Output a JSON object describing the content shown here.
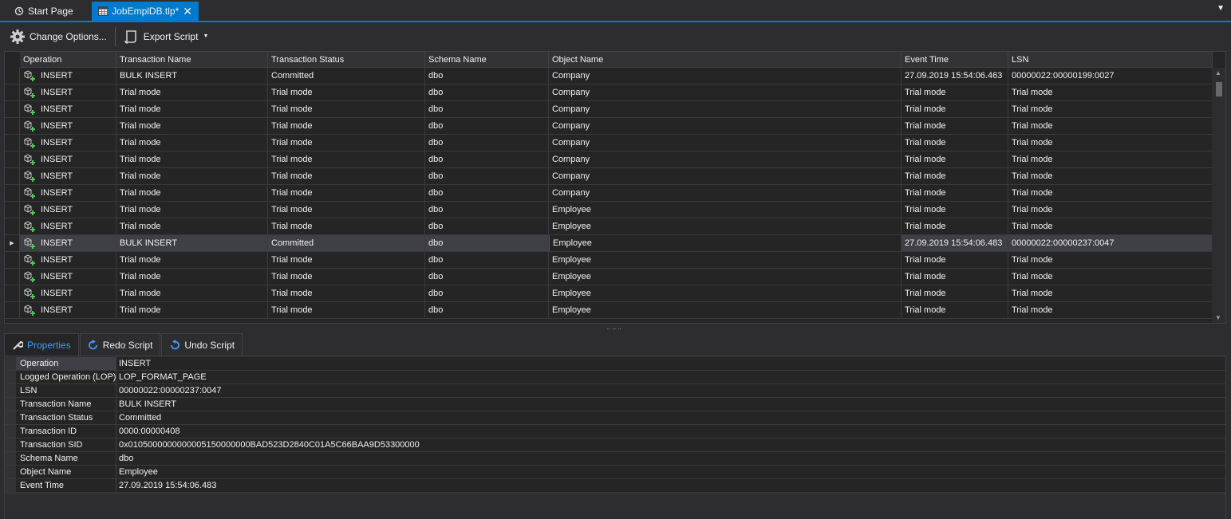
{
  "tabs": {
    "start_label": "Start Page",
    "doc_label": "JobEmplDB.tlp*",
    "close_glyph": "✕",
    "overflow_glyph": "▼"
  },
  "toolbar": {
    "options_label": "Change Options...",
    "export_label": "Export Script"
  },
  "grid": {
    "columns": [
      "Operation",
      "Transaction Name",
      "Transaction Status",
      "Schema Name",
      "Object Name",
      "Event Time",
      "LSN"
    ],
    "selected_row": 10,
    "rows": [
      [
        "INSERT",
        "BULK INSERT",
        "Committed",
        "dbo",
        "Company",
        "27.09.2019 15:54:06.463",
        "00000022:00000199:0027"
      ],
      [
        "INSERT",
        "Trial mode",
        "Trial mode",
        "dbo",
        "Company",
        "Trial mode",
        "Trial mode"
      ],
      [
        "INSERT",
        "Trial mode",
        "Trial mode",
        "dbo",
        "Company",
        "Trial mode",
        "Trial mode"
      ],
      [
        "INSERT",
        "Trial mode",
        "Trial mode",
        "dbo",
        "Company",
        "Trial mode",
        "Trial mode"
      ],
      [
        "INSERT",
        "Trial mode",
        "Trial mode",
        "dbo",
        "Company",
        "Trial mode",
        "Trial mode"
      ],
      [
        "INSERT",
        "Trial mode",
        "Trial mode",
        "dbo",
        "Company",
        "Trial mode",
        "Trial mode"
      ],
      [
        "INSERT",
        "Trial mode",
        "Trial mode",
        "dbo",
        "Company",
        "Trial mode",
        "Trial mode"
      ],
      [
        "INSERT",
        "Trial mode",
        "Trial mode",
        "dbo",
        "Company",
        "Trial mode",
        "Trial mode"
      ],
      [
        "INSERT",
        "Trial mode",
        "Trial mode",
        "dbo",
        "Employee",
        "Trial mode",
        "Trial mode"
      ],
      [
        "INSERT",
        "Trial mode",
        "Trial mode",
        "dbo",
        "Employee",
        "Trial mode",
        "Trial mode"
      ],
      [
        "INSERT",
        "BULK INSERT",
        "Committed",
        "dbo",
        "Employee",
        "27.09.2019 15:54:06.483",
        "00000022:00000237:0047"
      ],
      [
        "INSERT",
        "Trial mode",
        "Trial mode",
        "dbo",
        "Employee",
        "Trial mode",
        "Trial mode"
      ],
      [
        "INSERT",
        "Trial mode",
        "Trial mode",
        "dbo",
        "Employee",
        "Trial mode",
        "Trial mode"
      ],
      [
        "INSERT",
        "Trial mode",
        "Trial mode",
        "dbo",
        "Employee",
        "Trial mode",
        "Trial mode"
      ],
      [
        "INSERT",
        "Trial mode",
        "Trial mode",
        "dbo",
        "Employee",
        "Trial mode",
        "Trial mode"
      ]
    ],
    "row_icon": "insert-row-icon"
  },
  "bottom_tabs": {
    "properties_label": "Properties",
    "redo_label": "Redo Script",
    "undo_label": "Undo Script"
  },
  "properties": [
    {
      "name": "Operation",
      "value": "INSERT"
    },
    {
      "name": "Logged Operation (LOP)",
      "value": "LOP_FORMAT_PAGE"
    },
    {
      "name": "LSN",
      "value": "00000022:00000237:0047"
    },
    {
      "name": "Transaction Name",
      "value": "BULK INSERT"
    },
    {
      "name": "Transaction Status",
      "value": "Committed"
    },
    {
      "name": "Transaction ID",
      "value": "0000:00000408"
    },
    {
      "name": "Transaction SID",
      "value": "0x0105000000000005150000000BAD523D2840C01A5C66BAA9D53300000"
    },
    {
      "name": "Schema Name",
      "value": "dbo"
    },
    {
      "name": "Object Name",
      "value": "Employee"
    },
    {
      "name": "Event Time",
      "value": "27.09.2019 15:54:06.483"
    }
  ],
  "colors": {
    "accent": "#007acc",
    "background": "#2d2d30",
    "grid_bg": "#252526",
    "selected_row": "#3f3f46",
    "active_tab_text": "#3e9cff"
  }
}
